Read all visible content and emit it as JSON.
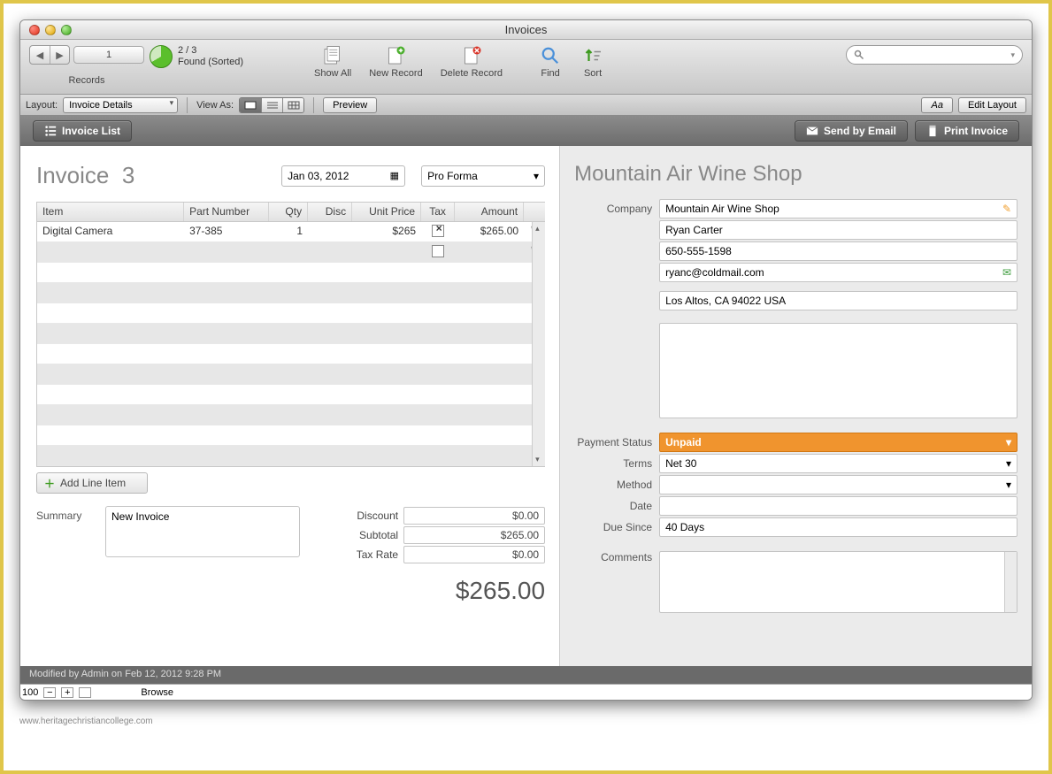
{
  "window": {
    "title": "Invoices"
  },
  "toolbar": {
    "record_indicator": "1",
    "found_line1": "2 / 3",
    "found_line2": "Found (Sorted)",
    "records_label": "Records",
    "showall": "Show All",
    "newrecord": "New Record",
    "deleterecord": "Delete Record",
    "find": "Find",
    "sort": "Sort",
    "search_placeholder": ""
  },
  "optrow": {
    "layout_label": "Layout:",
    "layout_value": "Invoice Details",
    "viewas_label": "View As:",
    "preview": "Preview",
    "aa": "Aa",
    "editlayout": "Edit Layout"
  },
  "actionbar": {
    "invoice_list": "Invoice List",
    "send_email": "Send by Email",
    "print": "Print Invoice"
  },
  "invoice": {
    "title": "Invoice",
    "number": "3",
    "date": "Jan 03, 2012",
    "type": "Pro Forma",
    "columns": {
      "item": "Item",
      "pn": "Part Number",
      "qty": "Qty",
      "disc": "Disc",
      "up": "Unit Price",
      "tax": "Tax",
      "amt": "Amount"
    },
    "line1": {
      "item": "Digital Camera",
      "pn": "37-385",
      "qty": "1",
      "disc": "",
      "up": "$265",
      "amt": "$265.00"
    },
    "addline": "Add Line Item",
    "summary_label": "Summary",
    "summary_value": "New Invoice",
    "discount_label": "Discount",
    "discount_value": "$0.00",
    "subtotal_label": "Subtotal",
    "subtotal_value": "$265.00",
    "taxrate_label": "Tax Rate",
    "taxrate_value": "$0.00",
    "grand_total": "$265.00"
  },
  "customer": {
    "title": "Mountain Air Wine Shop",
    "company_label": "Company",
    "company": "Mountain Air Wine Shop",
    "contact": "Ryan Carter",
    "phone": "650-555-1598",
    "email": "ryanc@coldmail.com",
    "address": "Los Altos, CA 94022 USA",
    "ps_label": "Payment Status",
    "ps_value": "Unpaid",
    "terms_label": "Terms",
    "terms_value": "Net 30",
    "method_label": "Method",
    "method_value": "",
    "date_label": "Date",
    "date_value": "",
    "due_label": "Due Since",
    "due_value": "40 Days",
    "comments_label": "Comments"
  },
  "status": {
    "modified": "Modified by Admin on Feb 12, 2012 9:28 PM",
    "zoom": "100",
    "mode": "Browse"
  },
  "watermark": "www.heritagechristiancollege.com"
}
